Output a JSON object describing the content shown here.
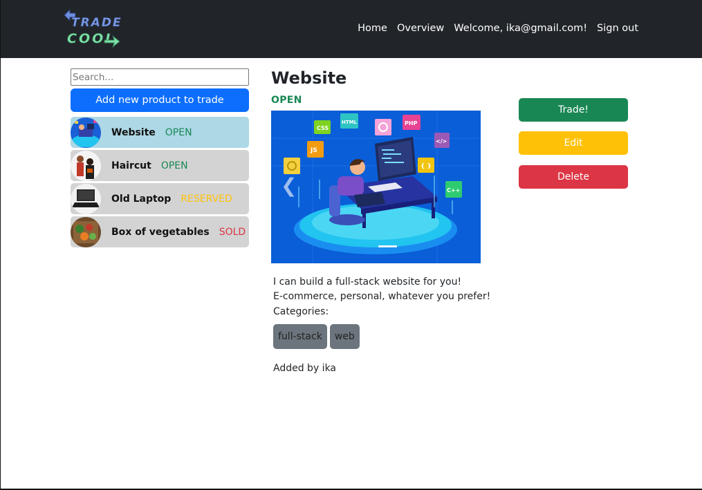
{
  "nav": {
    "logo_line1": "TRADE",
    "logo_line2": "COOL",
    "links": [
      "Home",
      "Overview",
      "Welcome, ika@gmail.com!",
      "Sign out"
    ]
  },
  "sidebar": {
    "search_placeholder": "Search...",
    "add_button": "Add new product to trade",
    "products": [
      {
        "name": "Website",
        "status": "OPEN",
        "status_color": "#198754",
        "active": true
      },
      {
        "name": "Haircut",
        "status": "OPEN",
        "status_color": "#198754",
        "active": false
      },
      {
        "name": "Old Laptop",
        "status": "RESERVED",
        "status_color": "#ffc107",
        "active": false
      },
      {
        "name": "Box of vegetables",
        "status": "SOLD",
        "status_color": "#dc3545",
        "active": false
      }
    ]
  },
  "product": {
    "title": "Website",
    "status": "OPEN",
    "description_lines": [
      "I can build a full-stack website for you!",
      "E-commerce, personal, whatever you prefer!"
    ],
    "categories_label": "Categories:",
    "categories": [
      "full-stack",
      "web"
    ],
    "added_by": "Added by ika",
    "image_tags": [
      "CSS",
      "HTML",
      "PHP",
      "JS",
      "</>",
      "{ }",
      "C++"
    ]
  },
  "actions": {
    "trade": "Trade!",
    "edit": "Edit",
    "delete": "Delete"
  },
  "colors": {
    "navbar": "#212529",
    "primary": "#0d6efd",
    "success": "#198754",
    "warning": "#ffc107",
    "danger": "#dc3545",
    "secondary": "#6c757d",
    "active_item": "#add8e6",
    "item": "#d3d3d3"
  }
}
